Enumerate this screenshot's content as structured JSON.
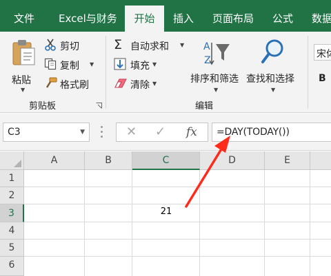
{
  "tabs": [
    {
      "label": "文件",
      "active": false
    },
    {
      "label": "Excel与财务",
      "active": false
    },
    {
      "label": "开始",
      "active": true
    },
    {
      "label": "插入",
      "active": false
    },
    {
      "label": "页面布局",
      "active": false
    },
    {
      "label": "公式",
      "active": false
    },
    {
      "label": "数据",
      "active": false
    }
  ],
  "clipboard": {
    "paste": "粘贴",
    "cut": "剪切",
    "copy": "复制",
    "format_painter": "格式刷",
    "group_label": "剪贴板"
  },
  "editing": {
    "autosum": "自动求和",
    "fill": "填充",
    "clear": "清除",
    "sort_filter": "排序和筛选",
    "find_select": "查找和选择",
    "group_label": "编辑"
  },
  "font": {
    "name_partial": "宋体",
    "bold": "B"
  },
  "formula_bar": {
    "name_box": "C3",
    "fx": "fx",
    "formula": "=DAY(TODAY())"
  },
  "grid": {
    "columns": [
      "A",
      "B",
      "C",
      "D",
      "E"
    ],
    "selected_column": "C",
    "rows": [
      "1",
      "2",
      "3",
      "4",
      "5",
      "6"
    ],
    "selected_row": "3",
    "cells": {
      "C3": "21"
    }
  },
  "colors": {
    "accent": "#217346",
    "annotation_arrow": "#ff2a1a"
  }
}
